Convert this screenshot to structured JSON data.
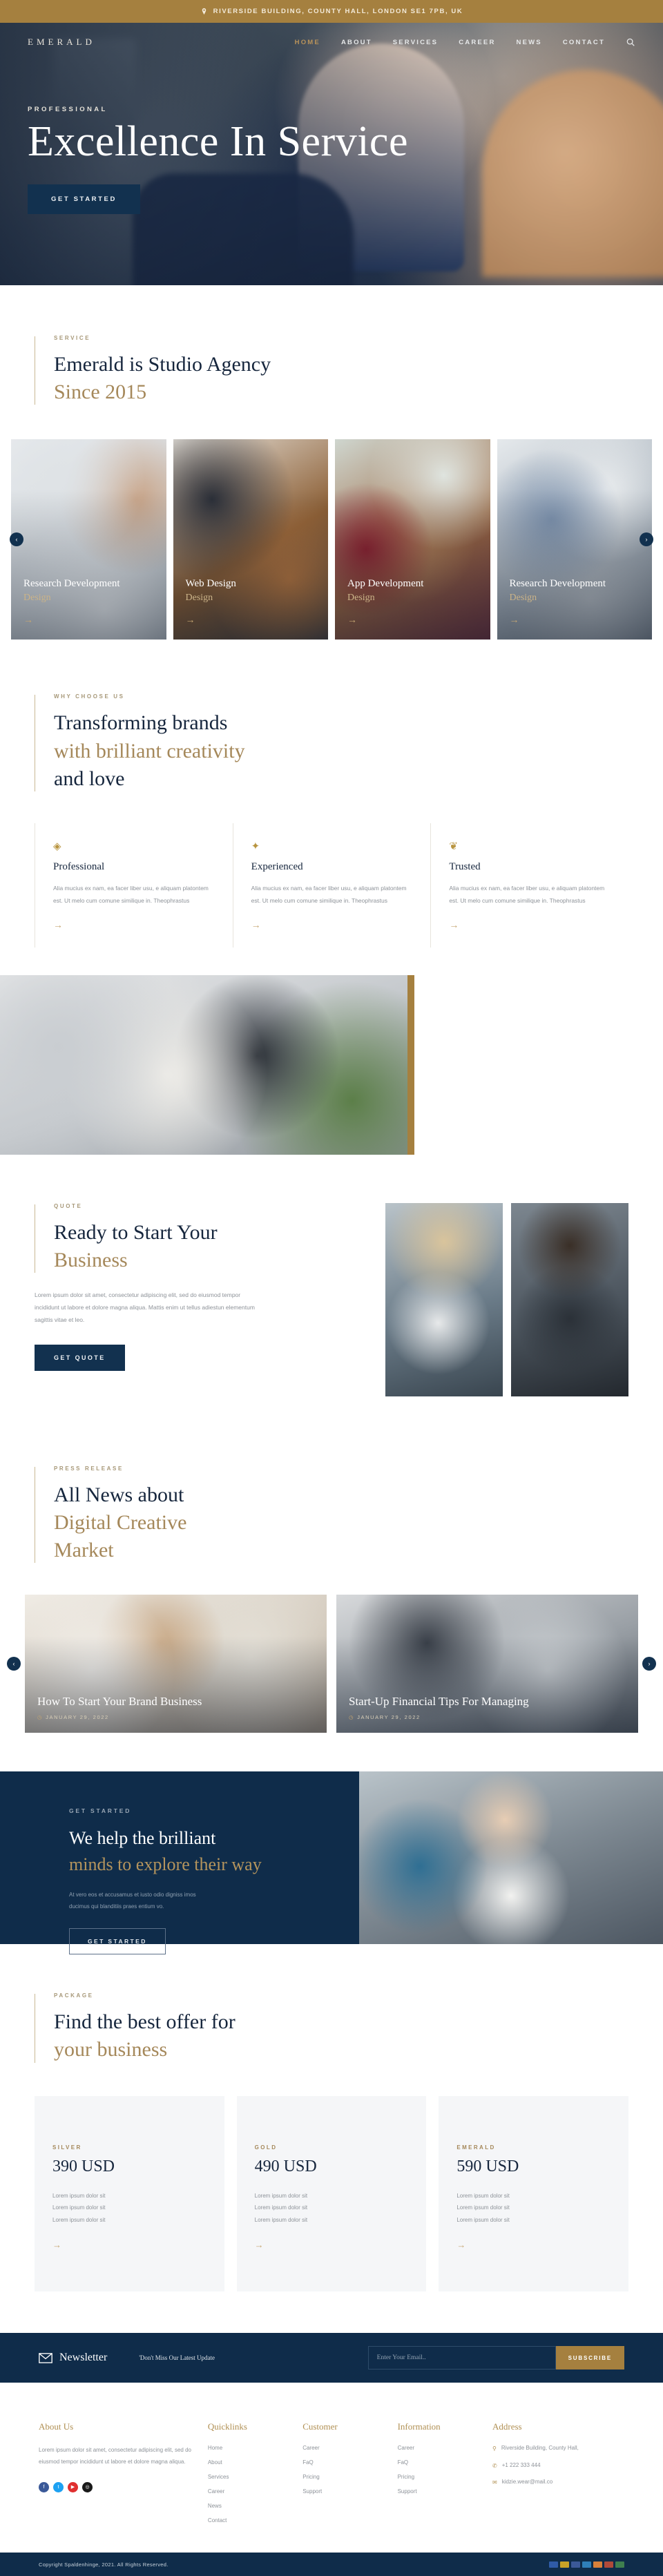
{
  "topbar": {
    "address": "RIVERSIDE BUILDING, COUNTY HALL, LONDON SE1 7PB, UK",
    "pin_icon": "map-pin-icon"
  },
  "nav": {
    "logo": "EMERALD",
    "items": [
      {
        "label": "HOME",
        "active": true
      },
      {
        "label": "ABOUT",
        "active": false
      },
      {
        "label": "SERVICES",
        "active": false
      },
      {
        "label": "CAREER",
        "active": false
      },
      {
        "label": "NEWS",
        "active": false
      },
      {
        "label": "CONTACT",
        "active": false
      }
    ],
    "search_icon": "search-icon"
  },
  "hero": {
    "eyebrow": "PROFESSIONAL",
    "title": "Excellence In Service",
    "cta": "GET STARTED"
  },
  "service_section": {
    "eyebrow": "SERVICE",
    "title_line1": "Emerald is Studio Agency",
    "title_line2": "Since 2015",
    "prev_icon": "chevron-left-icon",
    "next_icon": "chevron-right-icon",
    "cards": [
      {
        "title": "Research Development",
        "subtitle": "Design",
        "arrow": "→"
      },
      {
        "title": "Web Design",
        "subtitle": "Design",
        "arrow": "→"
      },
      {
        "title": "App Development",
        "subtitle": "Design",
        "arrow": "→"
      },
      {
        "title": "Research Development",
        "subtitle": "Design",
        "arrow": "→"
      }
    ]
  },
  "why_section": {
    "eyebrow": "WHY CHOOSE US",
    "title_line1": "Transforming brands",
    "title_line2": "with brilliant creativity",
    "title_line3": "and love",
    "features": [
      {
        "icon": "diamond-icon",
        "glyph": "◈",
        "title": "Professional",
        "text": "Alia mucius ex nam, ea facer liber usu, e aliquam platontem est. Ut melo cum comune similique in. Theophrastus",
        "arrow": "→"
      },
      {
        "icon": "gear-icon",
        "glyph": "✦",
        "title": "Experienced",
        "text": "Alia mucius ex nam, ea facer liber usu, e aliquam platontem est. Ut melo cum comune similique in. Theophrastus",
        "arrow": "→"
      },
      {
        "icon": "badge-icon",
        "glyph": "❦",
        "title": "Trusted",
        "text": "Alia mucius ex nam, ea facer liber usu, e aliquam platontem est. Ut melo cum comune similique in. Theophrastus",
        "arrow": "→"
      }
    ]
  },
  "quote_section": {
    "eyebrow": "QUOTE",
    "title_line1": "Ready to Start Your",
    "title_line2": "Business",
    "text": "Lorem ipsum dolor sit amet, consectetur adipiscing elit, sed do eiusmod tempor incididunt ut labore et dolore magna aliqua. Mattis enim ut tellus adiestun elementum sagittis vitae et leo.",
    "cta": "GET QUOTE"
  },
  "news_section": {
    "eyebrow": "PRESS RELEASE",
    "title_line1": "All News about",
    "title_line2": "Digital Creative",
    "title_line3": "Market",
    "prev_icon": "chevron-left-icon",
    "next_icon": "chevron-right-icon",
    "cards": [
      {
        "title": "How To Start Your Brand Business",
        "date": "JANUARY 29, 2022",
        "calendar_icon": "calendar-icon"
      },
      {
        "title": "Start-Up Financial Tips For Managing",
        "date": "JANUARY 29, 2022",
        "calendar_icon": "calendar-icon"
      }
    ]
  },
  "cta_section": {
    "eyebrow": "GET STARTED",
    "title_line1": "We help the brilliant",
    "title_line2": "minds to explore their way",
    "text_line1": "At vero eos et accusamus et iusto odio digniss imos",
    "text_line2": "ducimus qui blanditiis praes entium vo.",
    "button": "GET STARTED"
  },
  "pricing_section": {
    "eyebrow": "PACKAGE",
    "title_line1": "Find the best offer for",
    "title_line2": "your business",
    "plans": [
      {
        "tier": "SILVER",
        "amount": "390 USD",
        "features": "Lorem ipsum dolor sit\nLorem ipsum dolor sit\nLorem ipsum dolor sit",
        "arrow": "→"
      },
      {
        "tier": "GOLD",
        "amount": "490 USD",
        "features": "Lorem ipsum dolor sit\nLorem ipsum dolor sit\nLorem ipsum dolor sit",
        "arrow": "→"
      },
      {
        "tier": "EMERALD",
        "amount": "590 USD",
        "features": "Lorem ipsum dolor sit\nLorem ipsum dolor sit\nLorem ipsum dolor sit",
        "arrow": "→"
      }
    ]
  },
  "newsletter": {
    "mail_icon": "mail-icon",
    "title": "Newsletter",
    "subtitle": "'Don't Miss Our Latest Update",
    "placeholder": "Enter Your Email..",
    "button": "SUBSCRIBE"
  },
  "footer": {
    "about": {
      "heading": "About Us",
      "text": "Lorem ipsum dolor sit amet, consectetur adipiscing elit, sed do eiusmod tempor incididunt ut labore et dolore magna aliqua.",
      "socials": [
        {
          "name": "facebook-icon",
          "glyph": "f",
          "color": "#3b5998"
        },
        {
          "name": "twitter-icon",
          "glyph": "t",
          "color": "#1da1f2"
        },
        {
          "name": "youtube-icon",
          "glyph": "▶",
          "color": "#e02f2f"
        },
        {
          "name": "instagram-icon",
          "glyph": "◎",
          "color": "#1a1a1a"
        }
      ]
    },
    "quicklinks": {
      "heading": "Quicklinks",
      "items": [
        "Home",
        "About",
        "Services",
        "Career",
        "News",
        "Contact"
      ]
    },
    "customer": {
      "heading": "Customer",
      "items": [
        "Career",
        "FaQ",
        "Pricing",
        "Support"
      ]
    },
    "information": {
      "heading": "Information",
      "items": [
        "Career",
        "FaQ",
        "Pricing",
        "Support"
      ]
    },
    "address": {
      "heading": "Address",
      "rows": [
        {
          "icon": "map-pin-icon",
          "glyph": "⚲",
          "text": "Riverside Building, County Hall,"
        },
        {
          "icon": "phone-icon",
          "glyph": "✆",
          "text": "+1 222 333 444"
        },
        {
          "icon": "mail-icon",
          "glyph": "✉",
          "text": "kidzie.wear@mail.co"
        }
      ]
    }
  },
  "copyright": {
    "text": "Copyright Spaldenhinge, 2021. All Rights Reserved.",
    "payments": [
      {
        "name": "visa-card-icon",
        "color": "#2f5ba8"
      },
      {
        "name": "mastercard-icon",
        "color": "#c9a227"
      },
      {
        "name": "paypal-icon",
        "color": "#3b5998"
      },
      {
        "name": "amex-icon",
        "color": "#2f7fb8"
      },
      {
        "name": "discover-icon",
        "color": "#d8803a"
      },
      {
        "name": "maestro-icon",
        "color": "#b04a3a"
      },
      {
        "name": "jcb-icon",
        "color": "#3f7f4f"
      }
    ]
  },
  "colors": {
    "gold": "#a5803f",
    "navy": "#0f2c4a",
    "dark_text": "#16263d",
    "muted": "#8d9298"
  }
}
